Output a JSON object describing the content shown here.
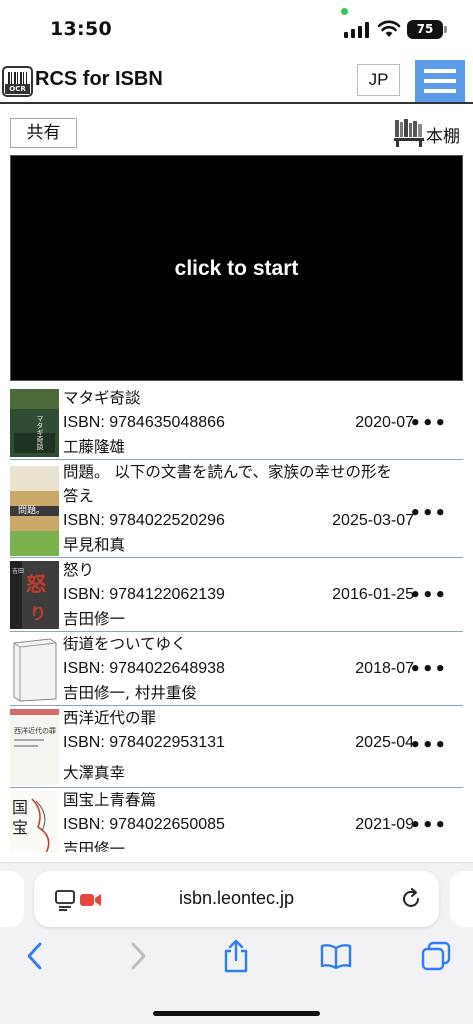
{
  "status": {
    "time": "13:50",
    "battery": "75"
  },
  "header": {
    "title": "RCS for ISBN",
    "logo_text": "OCR",
    "lang_button": "JP"
  },
  "toolbar": {
    "share_label": "共有",
    "bookshelf_label": "本棚"
  },
  "scanner": {
    "prompt": "click to start"
  },
  "books": [
    {
      "title": "マタギ奇談",
      "isbn": "ISBN: 9784635048866",
      "date": "2020-07",
      "author": "工藤隆雄"
    },
    {
      "title": "問題。 以下の文書を読んで、家族の幸せの形を",
      "title2": "答え",
      "isbn": "ISBN: 9784022520296",
      "date": "2025-03-07",
      "author": "早見和真"
    },
    {
      "title": "怒り",
      "isbn": "ISBN: 9784122062139",
      "date": "2016-01-25",
      "author": "吉田修一"
    },
    {
      "title": "街道をついてゆく",
      "isbn": "ISBN: 9784022648938",
      "date": "2018-07",
      "author": "吉田修一, 村井重俊"
    },
    {
      "title": "西洋近代の罪",
      "isbn": "ISBN: 9784022953131",
      "date": "2025-04",
      "author": "大澤真幸"
    },
    {
      "title": "国宝上青春篇",
      "isbn": "ISBN: 9784022650085",
      "date": "2021-09",
      "author": "吉田修一"
    }
  ],
  "more_label": "•••",
  "browser": {
    "url": "isbn.leontec.jp"
  },
  "colors": {
    "menu_accent": "#5b9be8",
    "list_divider": "#8aa3bf",
    "recording": "#e5453a"
  },
  "icons": [
    "reader-icon",
    "camera-icon",
    "reload-icon",
    "back-icon",
    "forward-icon",
    "share-icon",
    "bookmarks-icon",
    "tabs-icon"
  ]
}
